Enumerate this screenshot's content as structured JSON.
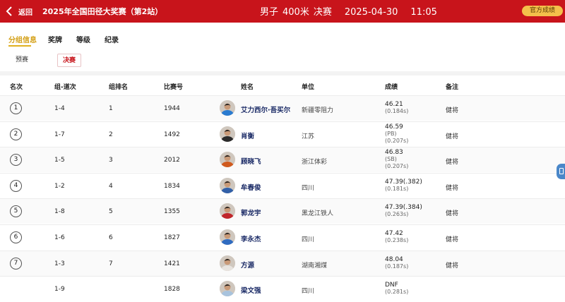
{
  "header": {
    "back_label": "返回",
    "event_title": "2025年全国田径大奖赛（第2站）",
    "gender": "男子",
    "event": "400米",
    "round": "决赛",
    "date": "2025-04-30",
    "time": "11:05",
    "official_button": "官方成绩"
  },
  "tabs": [
    {
      "label": "分组信息",
      "active": true
    },
    {
      "label": "奖牌",
      "active": false
    },
    {
      "label": "等级",
      "active": false
    },
    {
      "label": "纪录",
      "active": false
    }
  ],
  "rounds": [
    {
      "label": "预赛",
      "active": false
    },
    {
      "label": "决赛",
      "active": true
    }
  ],
  "table": {
    "headers": {
      "rank": "名次",
      "group_lane": "组-道次",
      "group_rank": "组排名",
      "bib": "比赛号",
      "name": "姓名",
      "unit": "单位",
      "result": "成绩",
      "note": "备注"
    },
    "rows": [
      {
        "rank": "1",
        "group_lane": "1-4",
        "group_rank": "1",
        "bib": "1944",
        "name": "艾力西尔·吾买尔",
        "unit": "新疆零阻力",
        "result": "46.21",
        "tags": "",
        "reaction": "(0.184s)",
        "note": "健将"
      },
      {
        "rank": "2",
        "group_lane": "1-7",
        "group_rank": "2",
        "bib": "1492",
        "name": "肖衡",
        "unit": "江苏",
        "result": "46.59",
        "tags": "(PB)",
        "reaction": "(0.207s)",
        "note": "健将"
      },
      {
        "rank": "3",
        "group_lane": "1-5",
        "group_rank": "3",
        "bib": "2012",
        "name": "顾晓飞",
        "unit": "浙江体彩",
        "result": "46.83",
        "tags": "(SB)",
        "reaction": "(0.207s)",
        "note": "健将"
      },
      {
        "rank": "4",
        "group_lane": "1-2",
        "group_rank": "4",
        "bib": "1834",
        "name": "牟春俊",
        "unit": "四川",
        "result": "47.39(.382)",
        "tags": "",
        "reaction": "(0.181s)",
        "note": "健将"
      },
      {
        "rank": "5",
        "group_lane": "1-8",
        "group_rank": "5",
        "bib": "1355",
        "name": "郭龙宇",
        "unit": "黑龙江铁人",
        "result": "47.39(.384)",
        "tags": "",
        "reaction": "(0.263s)",
        "note": "健将"
      },
      {
        "rank": "6",
        "group_lane": "1-6",
        "group_rank": "6",
        "bib": "1827",
        "name": "李永杰",
        "unit": "四川",
        "result": "47.42",
        "tags": "",
        "reaction": "(0.238s)",
        "note": "健将"
      },
      {
        "rank": "7",
        "group_lane": "1-3",
        "group_rank": "7",
        "bib": "1421",
        "name": "方源",
        "unit": "湖南湘煤",
        "result": "48.04",
        "tags": "",
        "reaction": "(0.187s)",
        "note": "健将"
      },
      {
        "rank": "",
        "group_lane": "1-9",
        "group_rank": "",
        "bib": "1828",
        "name": "梁文强",
        "unit": "四川",
        "result": "DNF",
        "tags": "",
        "reaction": "(0.281s)",
        "note": ""
      }
    ]
  },
  "colors": {
    "header_bg": "#c8141b",
    "accent_gold": "#e0b020",
    "official_btn": "#f4c04b",
    "name_text": "#1a2a66"
  },
  "icons": {
    "back": "chevron-left-icon",
    "avatar": "athlete-avatar-icon",
    "float": "side-panel-icon"
  }
}
